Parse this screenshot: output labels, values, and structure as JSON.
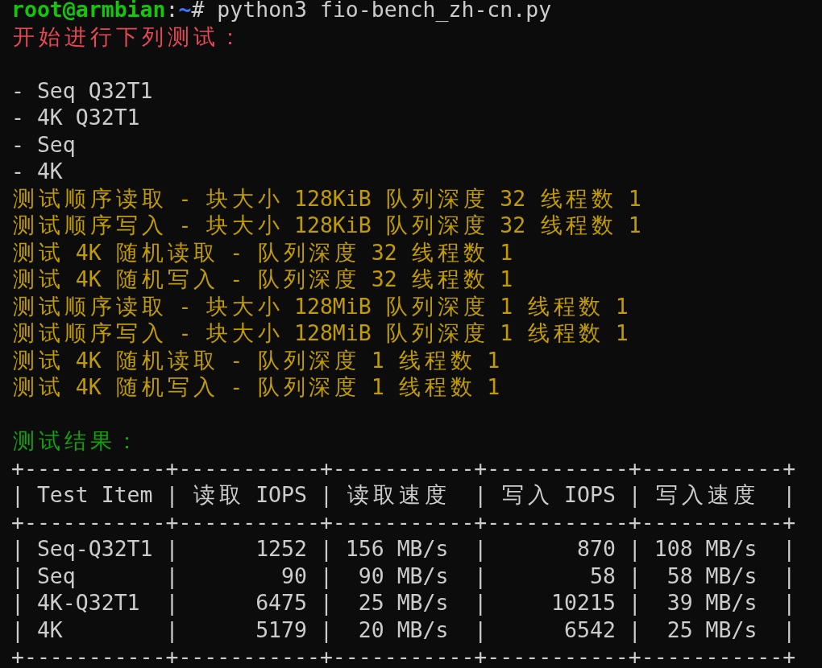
{
  "prompt": {
    "user_host": "root@armbian",
    "separator": ":",
    "path": "~",
    "symbol": "#",
    "command": "python3 fio-bench_zh-cn.py"
  },
  "lines": [
    {
      "kind": "title",
      "text": "开始进行下列测试："
    },
    {
      "kind": "blank"
    },
    {
      "kind": "list_item",
      "text": "- Seq Q32T1"
    },
    {
      "kind": "list_item",
      "text": "- 4K Q32T1"
    },
    {
      "kind": "list_item",
      "text": "- Seq"
    },
    {
      "kind": "list_item",
      "text": "- 4K"
    },
    {
      "kind": "progress",
      "text": "测试顺序读取 - 块大小 128KiB 队列深度 32 线程数 1"
    },
    {
      "kind": "progress",
      "text": "测试顺序写入 - 块大小 128KiB 队列深度 32 线程数 1"
    },
    {
      "kind": "progress",
      "text": "测试 4K 随机读取 - 队列深度 32 线程数 1"
    },
    {
      "kind": "progress",
      "text": "测试 4K 随机写入 - 队列深度 32 线程数 1"
    },
    {
      "kind": "progress",
      "text": "测试顺序读取 - 块大小 128MiB 队列深度 1 线程数 1"
    },
    {
      "kind": "progress",
      "text": "测试顺序写入 - 块大小 128MiB 队列深度 1 线程数 1"
    },
    {
      "kind": "progress",
      "text": "测试 4K 随机读取 - 队列深度 1 线程数 1"
    },
    {
      "kind": "progress",
      "text": "测试 4K 随机写入 - 队列深度 1 线程数 1"
    },
    {
      "kind": "blank"
    },
    {
      "kind": "section",
      "text": "测试结果："
    },
    {
      "kind": "table_border",
      "text": "+-----------+-----------+-----------+-----------+-----------+"
    },
    {
      "kind": "table_header",
      "text": "| Test Item | 读取 IOPS | 读取速度  | 写入 IOPS | 写入速度  |"
    },
    {
      "kind": "table_border",
      "text": "+-----------+-----------+-----------+-----------+-----------+"
    },
    {
      "kind": "table_row",
      "text": "| Seq-Q32T1 |      1252 | 156 MB/s  |       870 | 108 MB/s  |"
    },
    {
      "kind": "table_row",
      "text": "| Seq       |        90 |  90 MB/s  |        58 |  58 MB/s  |"
    },
    {
      "kind": "table_row",
      "text": "| 4K-Q32T1  |      6475 |  25 MB/s  |     10215 |  39 MB/s  |"
    },
    {
      "kind": "table_row",
      "text": "| 4K        |      5179 |  20 MB/s  |      6542 |  25 MB/s  |"
    },
    {
      "kind": "table_border",
      "text": "+-----------+-----------+-----------+-----------+-----------+"
    }
  ]
}
